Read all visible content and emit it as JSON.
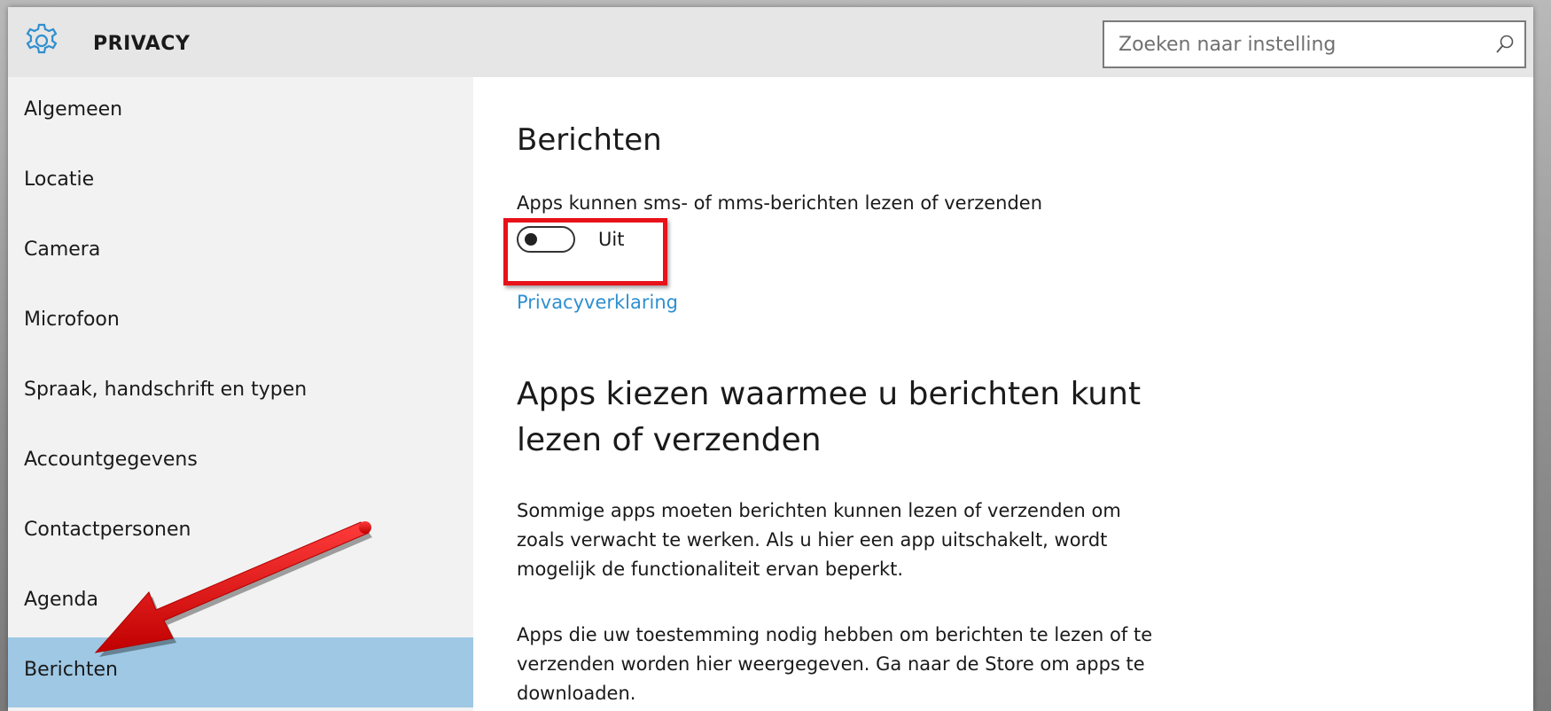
{
  "header": {
    "title": "PRIVACY",
    "search": {
      "placeholder": "Zoeken naar instelling",
      "value": ""
    },
    "icons": {
      "app": "gear-icon",
      "search": "search-icon"
    }
  },
  "sidebar": {
    "items": [
      {
        "label": "Algemeen",
        "selected": false
      },
      {
        "label": "Locatie",
        "selected": false
      },
      {
        "label": "Camera",
        "selected": false
      },
      {
        "label": "Microfoon",
        "selected": false
      },
      {
        "label": "Spraak, handschrift en typen",
        "selected": false
      },
      {
        "label": "Accountgegevens",
        "selected": false
      },
      {
        "label": "Contactpersonen",
        "selected": false
      },
      {
        "label": "Agenda",
        "selected": false
      },
      {
        "label": "Berichten",
        "selected": true
      }
    ]
  },
  "main": {
    "heading": "Berichten",
    "toggle_label": "Apps kunnen sms- of mms-berichten lezen of verzenden",
    "toggle_state": "Uit",
    "privacy_link": "Privacyverklaring",
    "section_heading": "Apps kiezen waarmee u berichten kunt lezen of verzenden",
    "paragraph1": "Sommige apps moeten berichten kunnen lezen of verzenden om zoals verwacht te werken. Als u hier een app uitschakelt, wordt mogelijk de functionaliteit ervan beperkt.",
    "paragraph2": "Apps die uw toestemming nodig hebben om berichten te lezen of te verzenden worden hier weergegeven. Ga naar de Store om apps te downloaden."
  },
  "colors": {
    "accent": "#2f8fd0",
    "selected_item": "#9ec8e4",
    "annotation": "#e8121a",
    "header_bg": "#e6e6e6",
    "sidebar_bg": "#f2f2f2"
  }
}
